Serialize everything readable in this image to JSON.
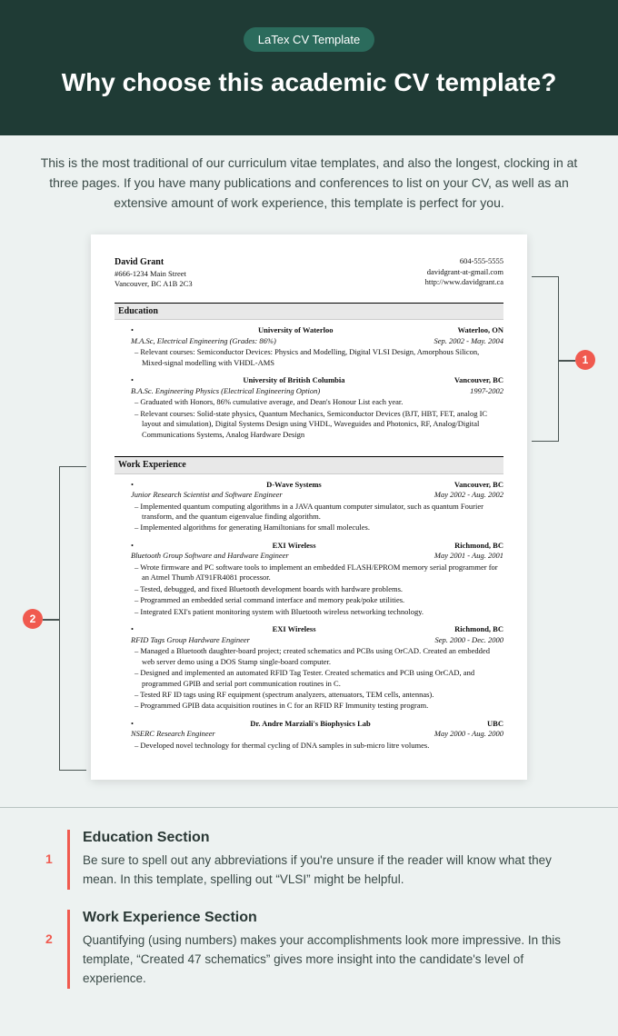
{
  "header": {
    "badge": "LaTex CV Template",
    "title": "Why choose this academic CV template?"
  },
  "intro": "This is the most traditional of our curriculum vitae templates, and also the longest, clocking in at three pages. If you have many publications and conferences to list on your CV, as well as an extensive amount of work experience, this template is perfect for you.",
  "cv": {
    "name": "David Grant",
    "addr1": "#666-1234 Main Street",
    "addr2": "Vancouver, BC A1B 2C3",
    "phone": "604-555-5555",
    "email": "davidgrant-at-gmail.com",
    "web": "http://www.davidgrant.ca",
    "sec1": "Education",
    "sec2": "Work Experience",
    "edu": [
      {
        "school": "University of Waterloo",
        "loc": "Waterloo, ON",
        "deg": "M.A.Sc, Electrical Engineering (Grades: 86%)",
        "dates": "Sep. 2002 - May. 2004",
        "pts": [
          "Relevant courses: Semiconductor Devices: Physics and Modelling, Digital VLSI Design, Amorphous Silicon, Mixed-signal modelling with VHDL-AMS"
        ]
      },
      {
        "school": "University of British Columbia",
        "loc": "Vancouver, BC",
        "deg": "B.A.Sc. Engineering Physics (Electrical Engineering Option)",
        "dates": "1997-2002",
        "pts": [
          "Graduated with Honors, 86% cumulative average, and Dean's Honour List each year.",
          "Relevant courses: Solid-state physics, Quantum Mechanics, Semiconductor Devices (BJT, HBT, FET, analog IC layout and simulation), Digital Systems Design using VHDL, Waveguides and Photonics, RF, Analog/Digital Communications Systems, Analog Hardware Design"
        ]
      }
    ],
    "exp": [
      {
        "co": "D-Wave Systems",
        "loc": "Vancouver, BC",
        "role": "Junior Research Scientist and Software Engineer",
        "dates": "May 2002 - Aug. 2002",
        "pts": [
          "Implemented quantum computing algorithms in a JAVA quantum computer simulator, such as quantum Fourier transform, and the quantum eigenvalue finding algorithm.",
          "Implemented algorithms for generating Hamiltonians for small molecules."
        ]
      },
      {
        "co": "EXI Wireless",
        "loc": "Richmond, BC",
        "role": "Bluetooth Group Software and Hardware Engineer",
        "dates": "May 2001 - Aug. 2001",
        "pts": [
          "Wrote firmware and PC software tools to implement an embedded FLASH/EPROM memory serial programmer for an Atmel Thumb AT91FR4081 processor.",
          "Tested, debugged, and fixed Bluetooth development boards with hardware problems.",
          "Programmed an embedded serial command interface and memory peak/poke utilities.",
          "Integrated EXI's patient monitoring system with Bluetooth wireless networking technology."
        ]
      },
      {
        "co": "EXI Wireless",
        "loc": "Richmond, BC",
        "role": "RFID Tags Group Hardware Engineer",
        "dates": "Sep. 2000 - Dec. 2000",
        "pts": [
          "Managed a Bluetooth daughter-board project; created schematics and PCBs using OrCAD. Created an embedded web server demo using a DOS Stamp single-board computer.",
          "Designed and implemented an automated RFID Tag Tester. Created schematics and PCB using OrCAD, and programmed GPIB and serial port communication routines in C.",
          "Tested RF ID tags using RF equipment (spectrum analyzers, attenuators, TEM cells, antennas).",
          "Programmed GPIB data acquisition routines in C for an RFID RF Immunity testing program."
        ]
      },
      {
        "co": "Dr. Andre Marziali's Biophysics Lab",
        "loc": "UBC",
        "role": "NSERC Research Engineer",
        "dates": "May 2000 - Aug. 2000",
        "pts": [
          "Developed novel technology for thermal cycling of DNA samples in sub-micro litre volumes."
        ]
      }
    ]
  },
  "callouts": {
    "n1": "1",
    "n2": "2"
  },
  "notes": [
    {
      "num": "1",
      "title": "Education Section",
      "body": "Be sure to spell out any abbreviations if you're unsure if the reader will know what they mean. In this template, spelling out “VLSI” might be helpful."
    },
    {
      "num": "2",
      "title": "Work Experience Section",
      "body": "Quantifying (using numbers) makes your accomplishments look more impressive. In this template, “Created 47 schematics” gives more insight into the candidate's level of experience."
    }
  ]
}
